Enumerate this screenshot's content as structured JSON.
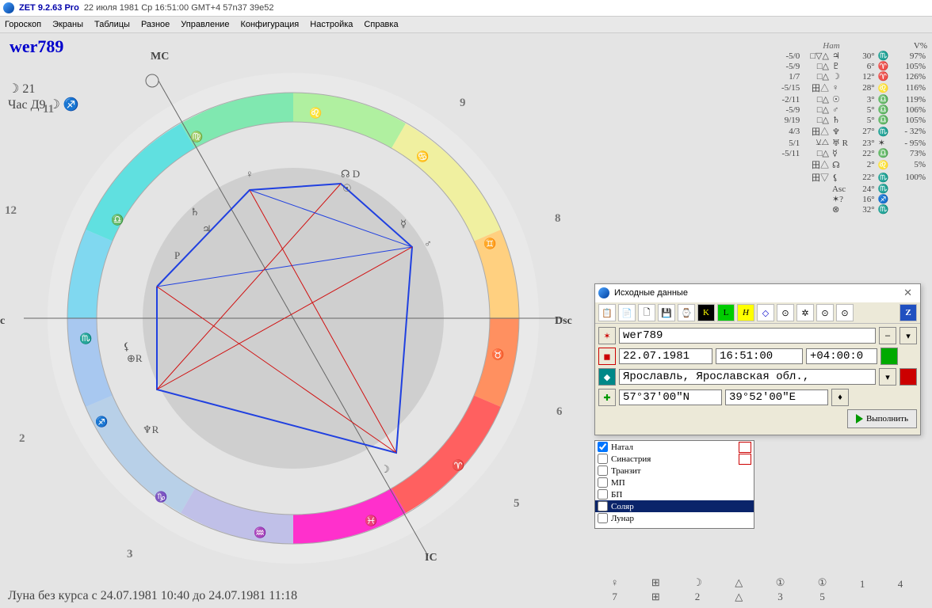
{
  "titlebar": {
    "app": "ZET 9.2.63 Pro",
    "date": "22 июля 1981  Ср  16:51:00 GMT+4 57n37  39e52"
  },
  "menu": [
    "Гороскоп",
    "Экраны",
    "Таблицы",
    "Разное",
    "Управление",
    "Конфигурация",
    "Настройка",
    "Справка"
  ],
  "chart": {
    "title": "wer789",
    "hour1": "☽ 21",
    "hour2": "Час Д9 ☽ ♐",
    "axes": {
      "mc": "MC",
      "ic": "IC",
      "asc": "c",
      "dsc": "Dsc"
    },
    "houses": [
      "2",
      "3",
      "5",
      "6",
      "8",
      "9",
      "11",
      "12"
    ],
    "footer": "Луна без курса с 24.07.1981 10:40 до 24.07.1981 11:18"
  },
  "table": {
    "hdr": "Нат",
    "vhdr": "V%",
    "rows": [
      {
        "a": "-5/0",
        "b": "□▽△",
        "p": "♃",
        "deg": "30°",
        "s": "♏",
        "v": "97%"
      },
      {
        "a": "-5/9",
        "b": "□△",
        "p": "♇",
        "deg": "6°",
        "s": "♈",
        "v": "105%"
      },
      {
        "a": "1/7",
        "b": "□△",
        "p": "☽",
        "deg": "12°",
        "s": "♈",
        "v": "126%"
      },
      {
        "a": "-5/15",
        "b": "田△",
        "p": "♀",
        "deg": "28°",
        "s": "♌",
        "v": "116%"
      },
      {
        "a": "-2/11",
        "b": "□△",
        "p": "☉",
        "deg": "3°",
        "s": "♎",
        "v": "119%"
      },
      {
        "a": "-5/9",
        "b": "□△",
        "p": "♂",
        "deg": "5°",
        "s": "♎",
        "v": "106%"
      },
      {
        "a": "9/19",
        "b": "□△",
        "p": "♄",
        "deg": "5°",
        "s": "♎",
        "v": "105%"
      },
      {
        "a": "4/3",
        "b": "田△",
        "p": "♆",
        "deg": "27°",
        "s": "♏",
        "v": "- 32%"
      },
      {
        "a": "5/1",
        "b": "⚺△",
        "p": "♅ R",
        "deg": "23°",
        "s": "✶",
        "v": "- 95%"
      },
      {
        "a": "-5/11",
        "b": "□△",
        "p": "☿",
        "deg": "22°",
        "s": "♎",
        "v": "73%"
      },
      {
        "a": "",
        "b": "田△",
        "p": "☊",
        "deg": "2°",
        "s": "♌",
        "v": "5%"
      },
      {
        "a": "",
        "b": "田▽",
        "p": "⚸",
        "deg": "22°",
        "s": "♏",
        "v": "100%"
      },
      {
        "a": "",
        "b": "",
        "p": "Asc",
        "deg": "24°",
        "s": "♏",
        "v": ""
      },
      {
        "a": "",
        "b": "",
        "p": "✶?",
        "deg": "16°",
        "s": "♐",
        "v": ""
      },
      {
        "a": "",
        "b": "",
        "p": "⊗",
        "deg": "32°",
        "s": "♏",
        "v": ""
      }
    ]
  },
  "dialog": {
    "title": "Исходные данные",
    "toolbar_icons": [
      "📋",
      "📄",
      "🗋",
      "💾",
      "☀",
      "K",
      "L",
      "H",
      "◇",
      "⊙",
      "✲",
      "⊙",
      "⊙"
    ],
    "name": "wer789",
    "date": "22.07.1981",
    "time": "16:51:00",
    "tz": "+04:00:0",
    "place": "Ярославль, Ярославская обл., ",
    "lat": "57°37'00\"N",
    "lon": "39°52'00\"E",
    "exec": "Выполнить"
  },
  "list": {
    "items": [
      {
        "label": "Натал",
        "checked": true,
        "sel": false,
        "badge": true
      },
      {
        "label": "Синастрия",
        "checked": false,
        "sel": false,
        "badge": true
      },
      {
        "label": "Транзит",
        "checked": false,
        "sel": false,
        "badge": false
      },
      {
        "label": "МП",
        "checked": false,
        "sel": false,
        "badge": false
      },
      {
        "label": "БП",
        "checked": false,
        "sel": false,
        "badge": false
      },
      {
        "label": "Соляр",
        "checked": false,
        "sel": true,
        "badge": false
      },
      {
        "label": "Лунар",
        "checked": false,
        "sel": false,
        "badge": false
      }
    ]
  },
  "glyphs_top": [
    "♀",
    "⊞",
    "☽",
    "△",
    "①",
    "①"
  ],
  "glyphs_bot": [
    "7",
    "⊞",
    "2",
    "△",
    "3",
    "5",
    "1",
    "4"
  ]
}
